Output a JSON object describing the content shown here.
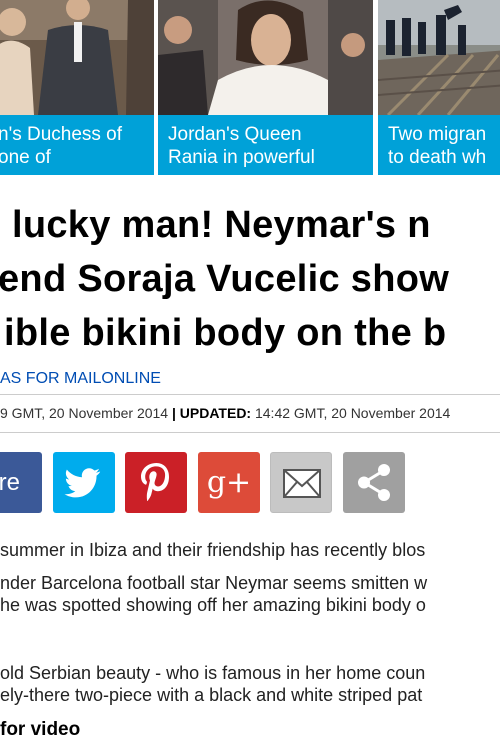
{
  "teasers": [
    {
      "line1": "n's Duchess of",
      "line2": "one of"
    },
    {
      "line1": "Jordan's Queen",
      "line2": "Rania in powerful"
    },
    {
      "line1": "Two migran",
      "line2": "to death wh"
    }
  ],
  "article": {
    "headline_lines": [
      "lucky man! Neymar's n",
      "end Soraja Vucelic show",
      "ible bikini body on the b"
    ],
    "byline": "AS FOR MAILONLINE",
    "published_time": "9 GMT, 20 November 2014",
    "separator": "|",
    "updated_label": "UPDATED:",
    "updated_time": "14:42 GMT, 20 November 2014"
  },
  "share": {
    "facebook_label": "re",
    "icons": [
      "twitter-icon",
      "pinterest-icon",
      "google-plus-icon",
      "email-icon",
      "share-icon"
    ],
    "google_plus_glyph": "g+",
    "colors": {
      "facebook": "#3b5998",
      "twitter": "#00aced",
      "pinterest": "#cb2027",
      "google_plus": "#dd4b39",
      "email": "#c8c8c8",
      "more": "#a0a0a0"
    }
  },
  "body": {
    "para1": " summer in Ibiza and their friendship has recently blos",
    "para2_line1": "nder Barcelona football star Neymar seems smitten w",
    "para2_line2": "he was spotted showing off her amazing bikini body o",
    "para3_line1": "old Serbian beauty - who is famous in her home coun",
    "para3_line2": "ely-there two-piece with a black and white striped pat",
    "scroll_text": "for video"
  },
  "colors": {
    "caption_bg": "#00a1d8",
    "byline": "#004db3"
  }
}
